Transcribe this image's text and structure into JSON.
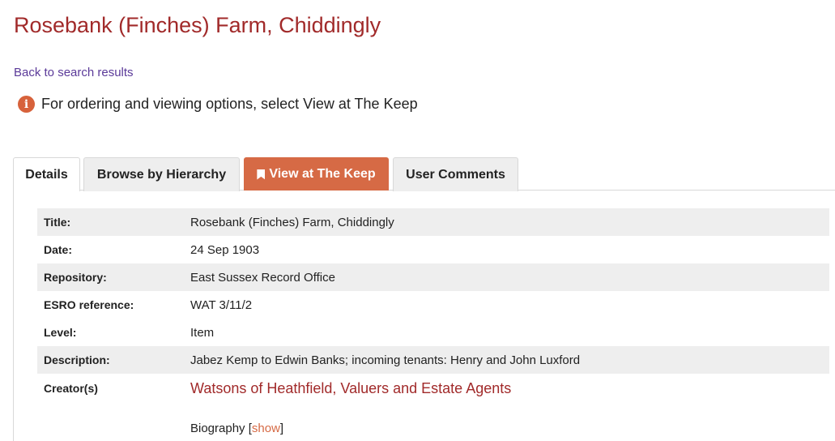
{
  "page": {
    "title": "Rosebank (Finches) Farm, Chiddingly",
    "back_link": "Back to search results",
    "notice": "For ordering and viewing options, select View at The Keep"
  },
  "icons": {
    "info": "info-circle-icon",
    "bookmark": "bookmark-icon"
  },
  "colors": {
    "title": "#a12a2a",
    "accent": "#d66a45",
    "link": "#5b3a99"
  },
  "tabs": [
    {
      "label": "Details",
      "active": true
    },
    {
      "label": "Browse by Hierarchy",
      "active": false
    },
    {
      "label": "View at The Keep",
      "active": false
    },
    {
      "label": "User Comments",
      "active": false
    }
  ],
  "details": {
    "rows": [
      {
        "label": "Title:",
        "value": "Rosebank (Finches) Farm, Chiddingly"
      },
      {
        "label": "Date:",
        "value": "24 Sep 1903"
      },
      {
        "label": "Repository:",
        "value": "East Sussex Record Office"
      },
      {
        "label": "ESRO reference:",
        "value": "WAT 3/11/2"
      },
      {
        "label": "Level:",
        "value": "Item"
      },
      {
        "label": "Description:",
        "value": "Jabez Kemp to Edwin Banks; incoming tenants: Henry and John Luxford"
      }
    ],
    "creator": {
      "label": "Creator(s)",
      "value": "Watsons of Heathfield, Valuers and Estate Agents"
    },
    "biography": {
      "label": "Biography",
      "bracket_open": "[",
      "toggle": "show",
      "bracket_close": "]"
    }
  }
}
